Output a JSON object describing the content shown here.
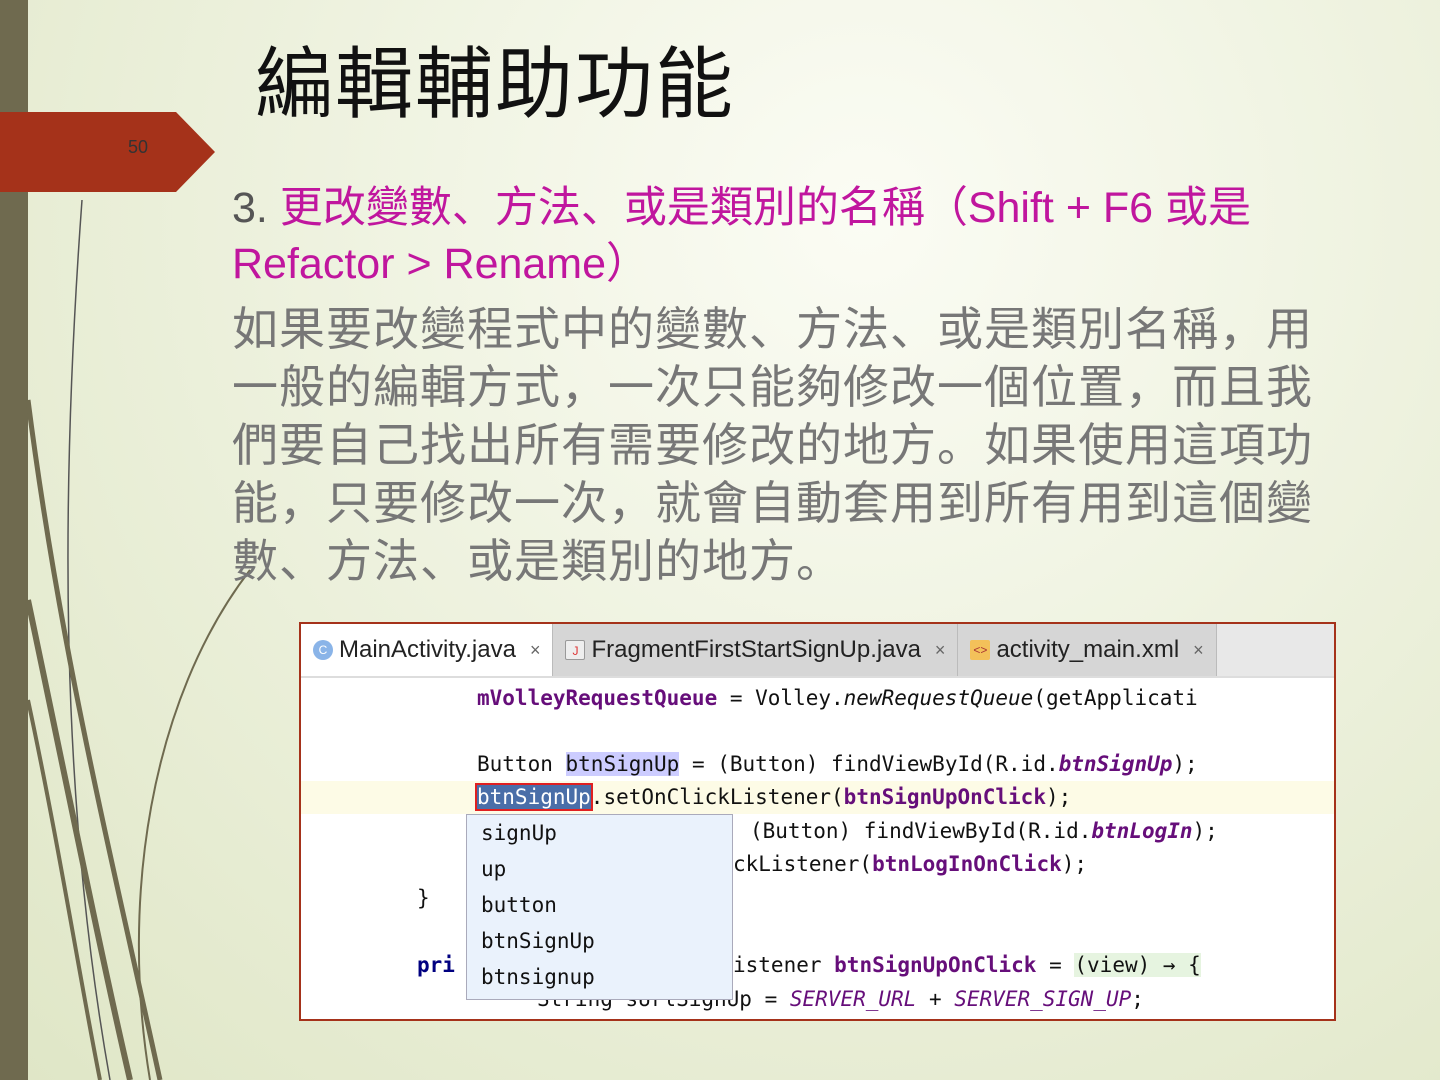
{
  "slide": {
    "title": "編輯輔助功能",
    "page_number": "50",
    "heading_number": "3.",
    "heading_text": "更改變數、方法、或是類別的名稱（Shift + F6 或是 Refactor > Rename）",
    "body": "如果要改變程式中的變數、方法、或是類別名稱，用一般的編輯方式，一次只能夠修改一個位置，而且我們要自己找出所有需要修改的地方。如果使用這項功能，只要修改一次，就會自動套用到所有用到這個變數、方法、或是類別的地方。"
  },
  "ide": {
    "tabs": [
      {
        "label": "MainActivity.java",
        "icon": "class-icon"
      },
      {
        "label": "FragmentFirstStartSignUp.java",
        "icon": "java-file-icon"
      },
      {
        "label": "activity_main.xml",
        "icon": "xml-file-icon"
      }
    ],
    "close": "×",
    "code": {
      "l1a": "mVolleyRequestQueue",
      "l1b": " = Volley.",
      "l1c": "newRequestQueue",
      "l1d": "(getApplicati",
      "l3a": "Button ",
      "l3b": "btnSignUp",
      "l3c": " = (Button) findViewById(R.id.",
      "l3d": "btnSignUp",
      "l3e": ");",
      "l4a": "btnSignUp",
      "l4b": ".setOnClickListener(",
      "l4c": "btnSignUpOnClick",
      "l4d": ");",
      "l5a": "(Button) findViewById(R.id.",
      "l5b": "btnLogIn",
      "l5c": ");",
      "l6a": "ckListener(",
      "l6b": "btnLogInOnClick",
      "l6c": ");",
      "l7": "}",
      "l9a": "pri",
      "l9b": "istener ",
      "l9c": "btnSignUpOnClick",
      "l9d": " = ",
      "l9e": "(view) → {",
      "l10a": "String sUrlSignUp = ",
      "l10b": "SERVER_URL",
      "l10c": " + ",
      "l10d": "SERVER_SIGN_UP",
      "l10e": ";"
    },
    "suggestions": [
      "signUp",
      "up",
      "button",
      "btnSignUp",
      "btnsignup"
    ]
  }
}
